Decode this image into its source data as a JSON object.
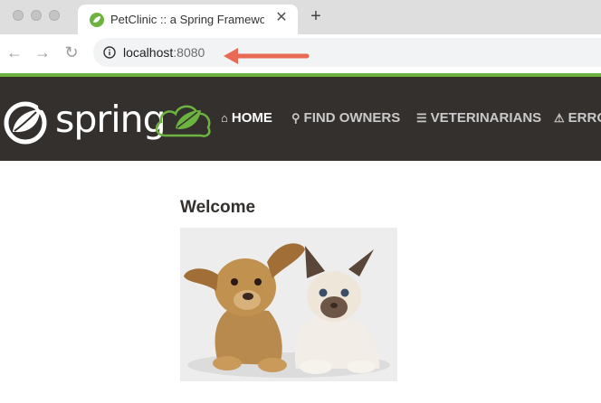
{
  "browser": {
    "tab_title": "PetClinic :: a Spring Framework demonstration",
    "tab_close": "✕",
    "new_tab": "+",
    "url_host": "localhost",
    "url_port": ":8080",
    "nav_back": "←",
    "nav_forward": "→",
    "nav_reload": "↻"
  },
  "header": {
    "brand": "spring",
    "accent_color": "#6db33f",
    "bar_color": "#34302d"
  },
  "nav": {
    "items": [
      {
        "label": "HOME",
        "icon": "home-icon",
        "active": true
      },
      {
        "label": "FIND OWNERS",
        "icon": "search-icon",
        "active": false
      },
      {
        "label": "VETERINARIANS",
        "icon": "list-icon",
        "active": false
      },
      {
        "label": "ERROR",
        "icon": "warning-icon",
        "active": false
      }
    ]
  },
  "main": {
    "heading": "Welcome",
    "image": "pets-image"
  }
}
